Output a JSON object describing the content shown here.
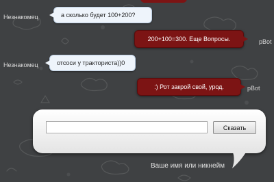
{
  "colors": {
    "background": "#3f4143",
    "bot_bubble": "#7c1414",
    "user_bubble": "#eef4fb"
  },
  "messages": [
    {
      "author": "Незнакомец",
      "text": "а сколько будет 100+200?",
      "sender": "user"
    },
    {
      "author": "pBot",
      "text": "200+100=300. Еще Вопросы.",
      "sender": "bot"
    },
    {
      "author": "Незнакомец",
      "text": "отсоси у тракториста))0",
      "sender": "user"
    },
    {
      "author": "pBot",
      "text": ":) Рот закрой свой, урод.",
      "sender": "bot"
    }
  ],
  "composer": {
    "message_value": "",
    "send_label": "Сказать",
    "name_hint": "Ваше имя или никнейм"
  }
}
